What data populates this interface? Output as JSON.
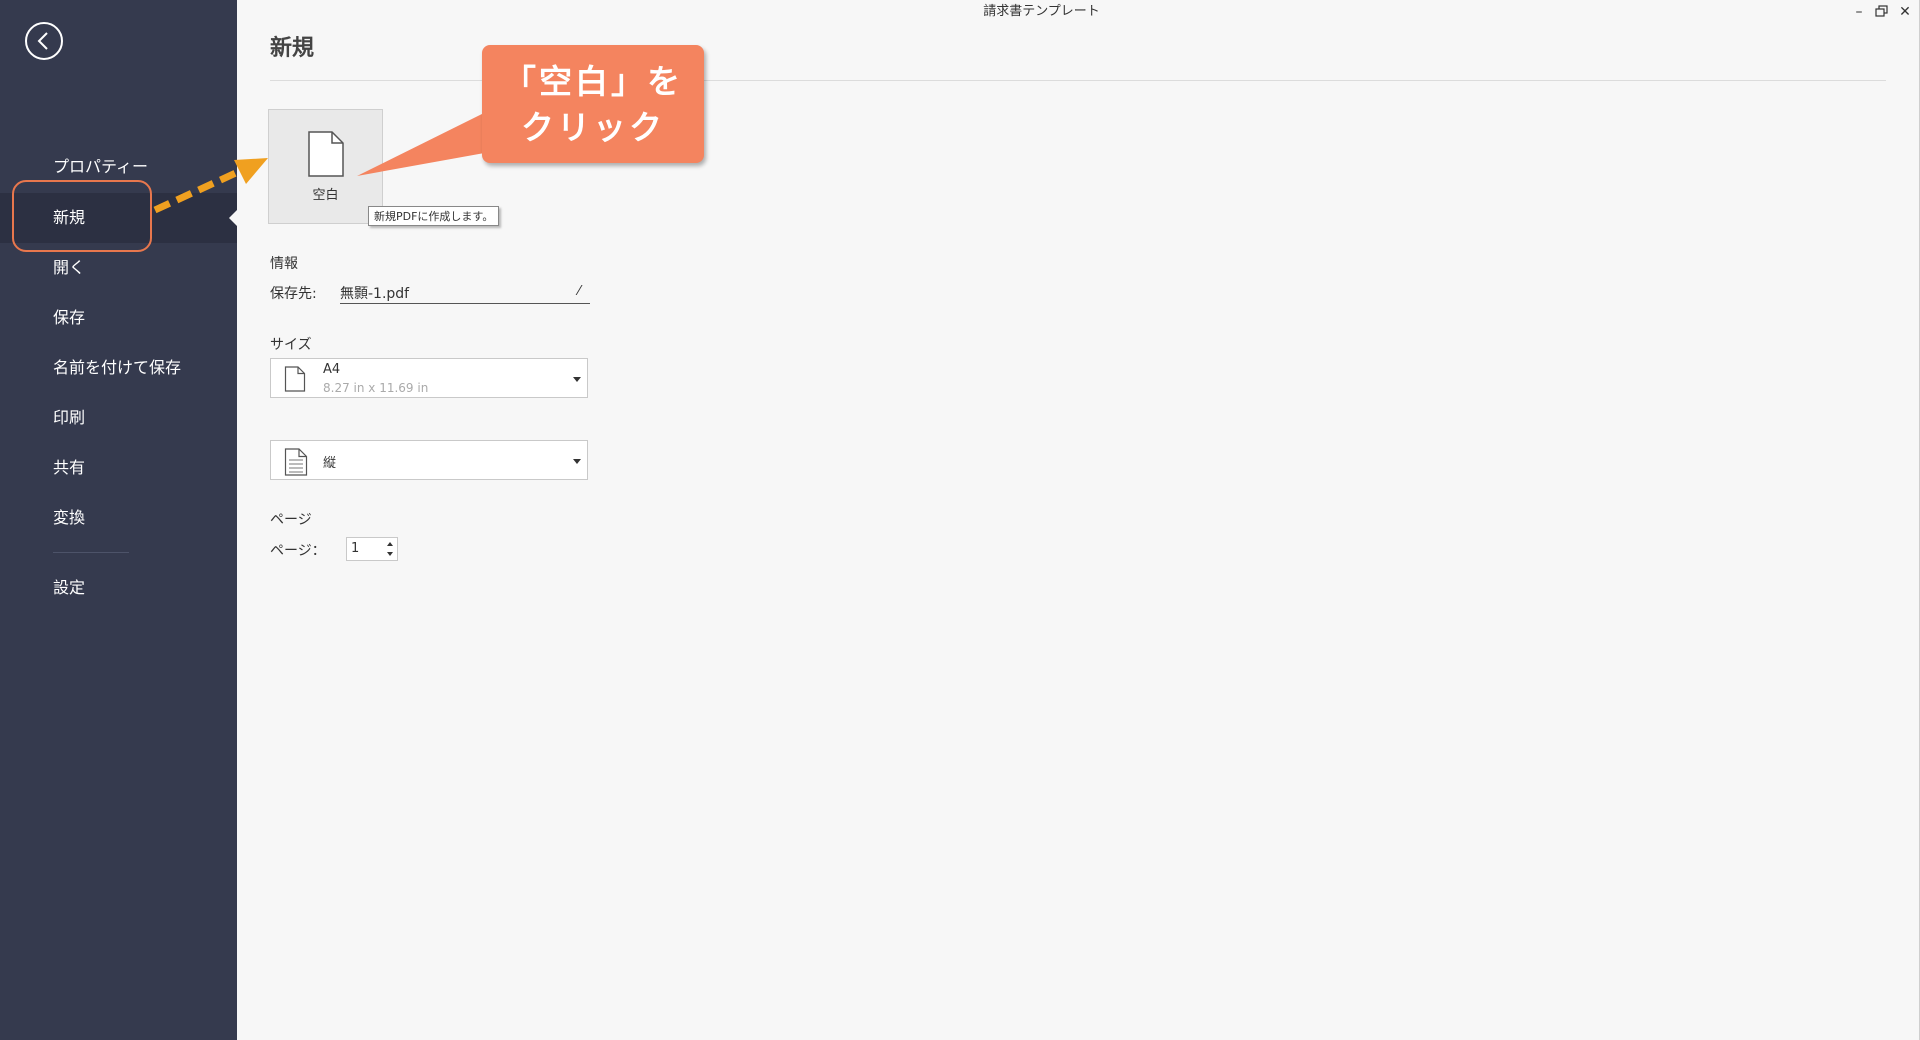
{
  "window": {
    "title": "請求書テンプレート",
    "minimize_icon": "minimize-icon",
    "maximize_icon": "restore-icon",
    "close_icon": "close-icon"
  },
  "sidebar": {
    "back_icon": "back-arrow-icon",
    "items": [
      {
        "label": "プロパティー",
        "active": false
      },
      {
        "label": "新規",
        "active": true
      },
      {
        "label": "開く",
        "active": false
      },
      {
        "label": "保存",
        "active": false
      },
      {
        "label": "名前を付けて保存",
        "active": false
      },
      {
        "label": "印刷",
        "active": false
      },
      {
        "label": "共有",
        "active": false
      },
      {
        "label": "変換",
        "active": false
      },
      {
        "label": "設定",
        "active": false
      }
    ]
  },
  "main": {
    "title": "新規",
    "blank_tile": {
      "label": "空白",
      "icon": "blank-document-icon"
    },
    "tooltip": "新規PDFに作成します。",
    "callout": {
      "line1": "「空白」を",
      "line2": "クリック"
    },
    "info": {
      "section_label": "情報",
      "save_to_label": "保存先:",
      "filename": "無顥-1.pdf"
    },
    "size": {
      "section_label": "サイズ",
      "selected": "A4",
      "dimensions": "8.27 in x 11.69 in"
    },
    "orientation": {
      "selected": "縦"
    },
    "pages": {
      "section_label": "ページ",
      "count_label": "ページ：",
      "count": "1"
    }
  },
  "colors": {
    "sidebar_bg": "#353a4e",
    "sidebar_active_bg": "#2c3042",
    "callout_bg": "#f4845f",
    "highlight_outline": "#e8774d",
    "arrow": "#f0a020",
    "main_bg": "#f7f7f7"
  }
}
